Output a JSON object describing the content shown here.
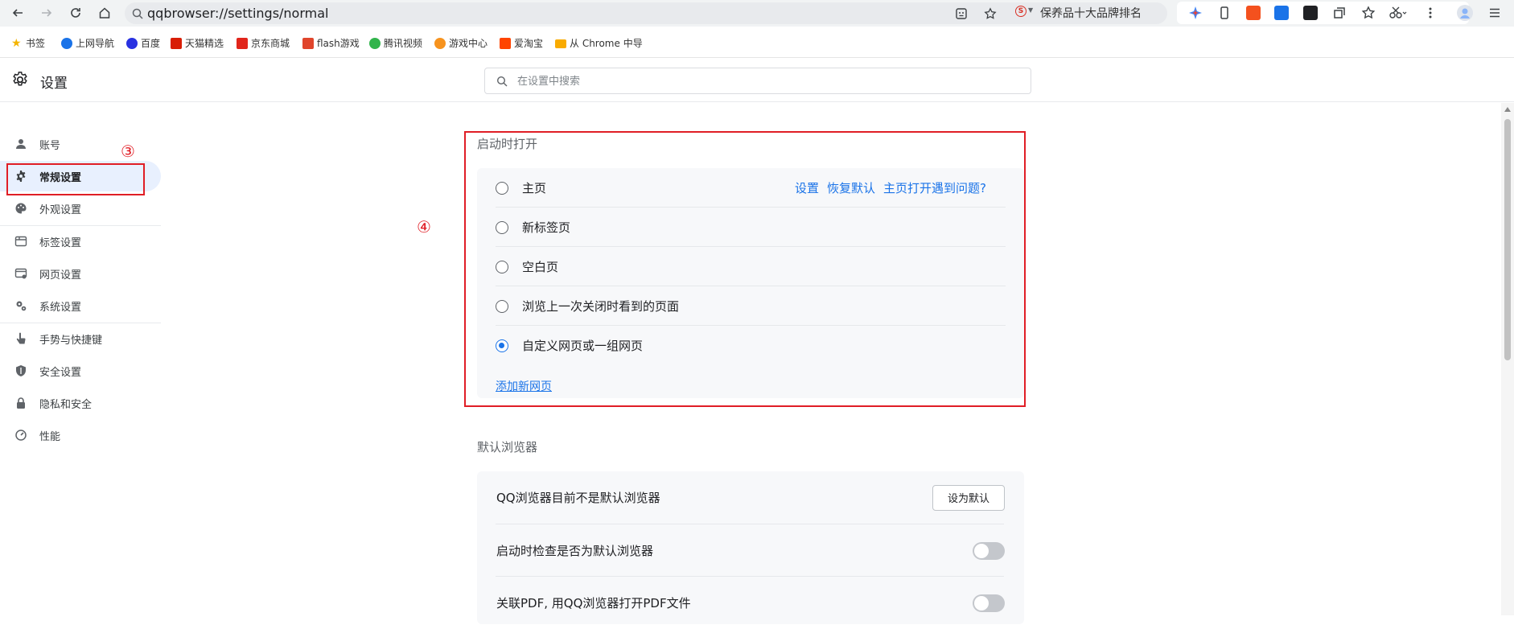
{
  "browser": {
    "url": "qqbrowser://settings/normal",
    "hot_search": "保养品十大品牌排名"
  },
  "bookmarks": [
    {
      "label": "书签",
      "icon": "star-icon",
      "color": "#f4b400"
    },
    {
      "label": "上网导航",
      "icon": "qq-nav-icon",
      "color": "#1a73e8"
    },
    {
      "label": "百度",
      "icon": "baidu-icon",
      "color": "#2932e1"
    },
    {
      "label": "天猫精选",
      "icon": "tmall-icon",
      "color": "#d81e06"
    },
    {
      "label": "京东商城",
      "icon": "jd-icon",
      "color": "#e1251b"
    },
    {
      "label": "flash游戏",
      "icon": "flash-game-icon",
      "color": "#e0452c"
    },
    {
      "label": "腾讯视频",
      "icon": "tencent-video-icon",
      "color": "#31b44b"
    },
    {
      "label": "游戏中心",
      "icon": "game-center-icon",
      "color": "#f7931e"
    },
    {
      "label": "爱淘宝",
      "icon": "ai-taobao-icon",
      "color": "#ff4400"
    },
    {
      "label": "从 Chrome 中导",
      "icon": "folder-icon",
      "color": "#f9ab00"
    }
  ],
  "settings": {
    "title": "设置",
    "search_placeholder": "在设置中搜索"
  },
  "sidebar": {
    "items": [
      {
        "label": "账号",
        "icon": "person-icon"
      },
      {
        "label": "常规设置",
        "icon": "gear-icon",
        "active": true
      },
      {
        "label": "外观设置",
        "icon": "palette-icon"
      },
      {
        "label": "标签设置",
        "icon": "tab-icon"
      },
      {
        "label": "网页设置",
        "icon": "webpage-icon"
      },
      {
        "label": "系统设置",
        "icon": "system-gears-icon"
      },
      {
        "label": "手势与快捷键",
        "icon": "gesture-hand-icon"
      },
      {
        "label": "安全设置",
        "icon": "shield-icon"
      },
      {
        "label": "隐私和安全",
        "icon": "lock-icon"
      },
      {
        "label": "性能",
        "icon": "speedometer-icon"
      }
    ]
  },
  "annotations": {
    "marker_3": "③",
    "marker_4": "④"
  },
  "startup": {
    "title": "启动时打开",
    "options": [
      {
        "label": "主页",
        "checked": false
      },
      {
        "label": "新标签页",
        "checked": false
      },
      {
        "label": "空白页",
        "checked": false
      },
      {
        "label": "浏览上一次关闭时看到的页面",
        "checked": false
      },
      {
        "label": "自定义网页或一组网页",
        "checked": true
      }
    ],
    "home_links": [
      "设置",
      "恢复默认",
      "主页打开遇到问题?"
    ],
    "add_page_link": "添加新网页"
  },
  "default_browser": {
    "title": "默认浏览器",
    "not_default_text": "QQ浏览器目前不是默认浏览器",
    "set_default_button": "设为默认",
    "check_on_startup": {
      "label": "启动时检查是否为默认浏览器",
      "enabled": false
    },
    "pdf_assoc": {
      "label": "关联PDF, 用QQ浏览器打开PDF文件",
      "enabled": false
    }
  }
}
